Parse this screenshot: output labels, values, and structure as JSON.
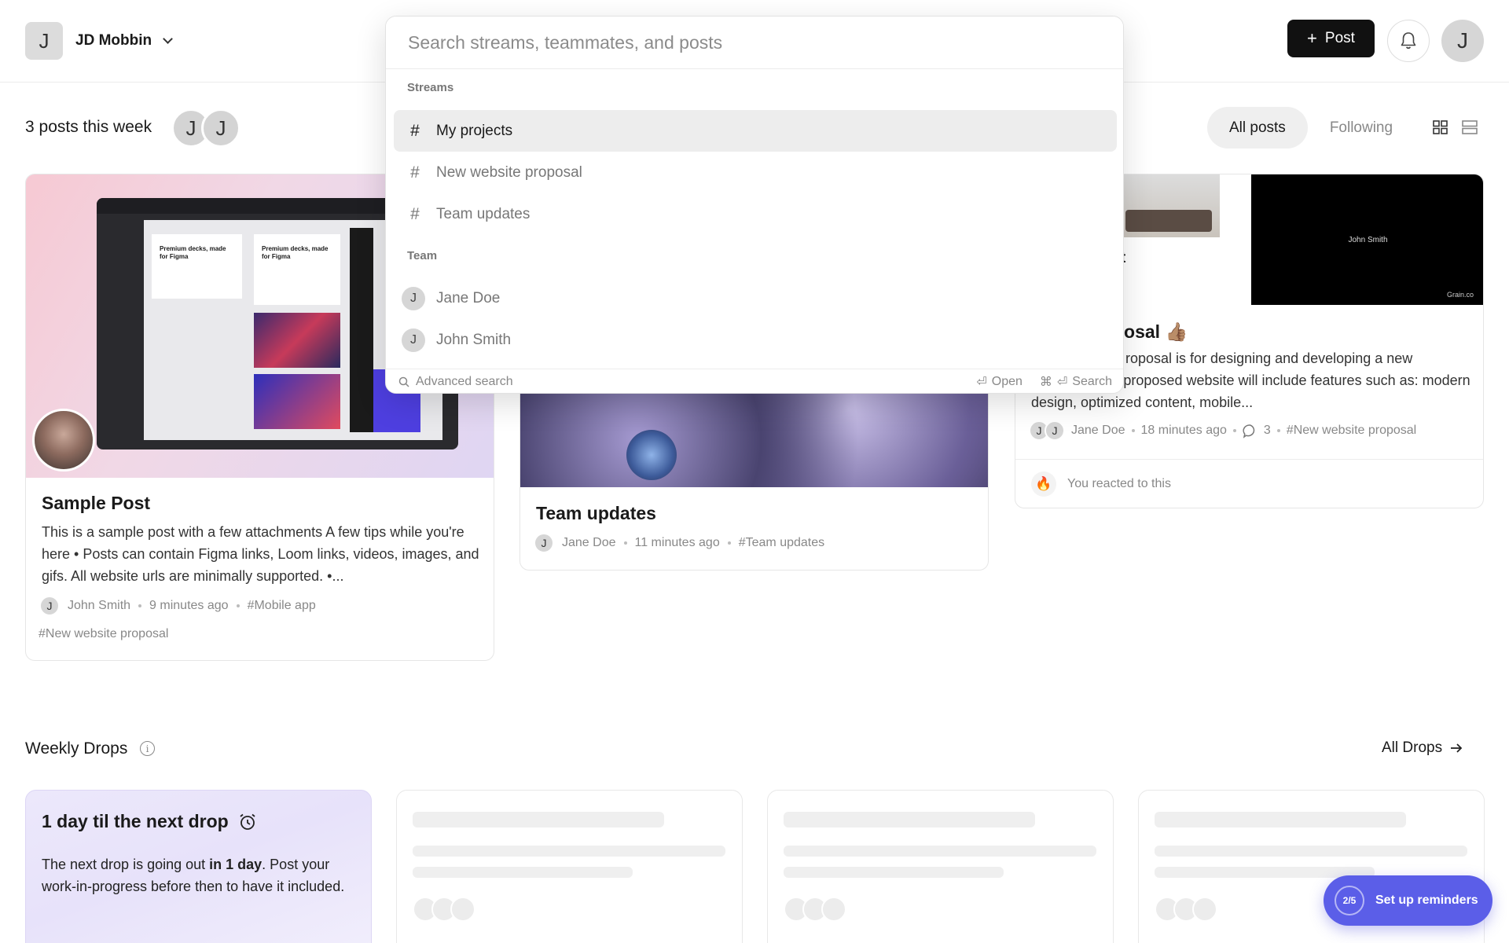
{
  "header": {
    "org_initial": "J",
    "org_name": "JD Mobbin",
    "post_label": "Post",
    "user_initial": "J"
  },
  "subheader": {
    "posts_count_text": "3 posts this week",
    "faces": [
      "J",
      "J"
    ],
    "tabs": [
      {
        "label": "All posts",
        "active": true
      },
      {
        "label": "Following",
        "active": false
      }
    ]
  },
  "search": {
    "placeholder": "Search streams, teammates, and posts",
    "streams_label": "Streams",
    "streams": [
      "My projects",
      "New website proposal",
      "Team updates"
    ],
    "team_label": "Team",
    "team": [
      {
        "initial": "J",
        "name": "Jane Doe"
      },
      {
        "initial": "J",
        "name": "John Smith"
      }
    ],
    "footer": {
      "advanced": "Advanced search",
      "open": "Open",
      "search": "Search"
    }
  },
  "posts": [
    {
      "title": "Sample Post",
      "body": "This is a sample post with a few attachments A few tips while you're here • Posts can contain Figma links, Loom links, videos, images, and gifs. All website urls are minimally supported. •...",
      "author_initial": "J",
      "author": "John Smith",
      "time": "9 minutes ago",
      "tag": "#Mobile app",
      "extra_tag": "#New website proposal",
      "thumb_text": {
        "heading_1": "Premium decks, made for Figma",
        "heading_2": "Premium decks, made for Figma"
      }
    },
    {
      "title": "Team updates",
      "author_initial": "J",
      "author": "Jane Doe",
      "time": "11 minutes ago",
      "tag": "#Team updates"
    },
    {
      "title_partial": "posal 👍🏽",
      "label_partial": "t",
      "body": "roposal is for designing and developing a new company. The proposed website will include features such as: modern design, optimized content, mobile...",
      "author_initials": [
        "J",
        "J"
      ],
      "author": "Jane Doe",
      "time": "18 minutes ago",
      "comments": "3",
      "tag": "#New website proposal",
      "reaction_text": "You reacted to this",
      "reaction_emoji": "🔥",
      "video_name": "John Smith",
      "video_brand": "Grain.co"
    }
  ],
  "weekly_drops": {
    "title": "Weekly Drops",
    "all_label": "All Drops",
    "main_card": {
      "heading": "1 day til the next drop",
      "text_pre": "The next drop is going out ",
      "text_bold": "in 1 day",
      "text_post": ". Post your work-in-progress before then to have it included."
    }
  },
  "reminder": {
    "progress": "2/5",
    "label": "Set up reminders"
  },
  "colors": {
    "accent": "#5b5ee8",
    "primary_button": "#111111"
  }
}
